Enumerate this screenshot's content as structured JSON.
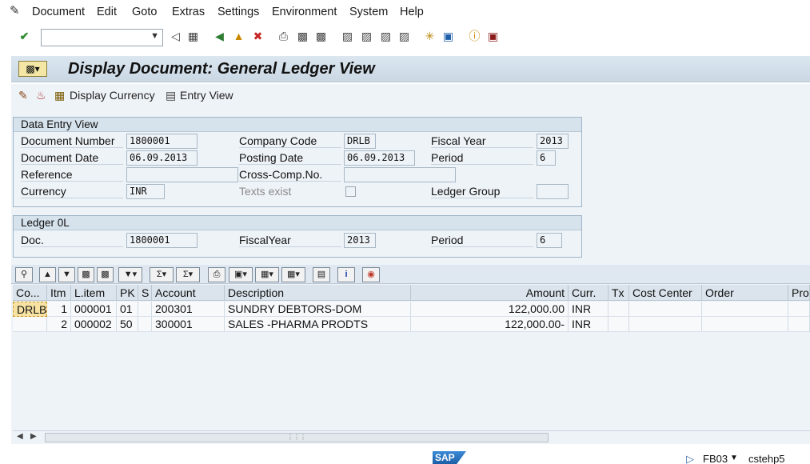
{
  "menu": [
    "Document",
    "Edit",
    "Goto",
    "Extras",
    "Settings",
    "Environment",
    "System",
    "Help"
  ],
  "toolbar": {
    "command_value": ""
  },
  "title": "Display Document: General Ledger View",
  "app_toolbar": {
    "display_currency": "Display Currency",
    "entry_view": "Entry View"
  },
  "data_entry": {
    "heading": "Data Entry View",
    "doc_number_label": "Document Number",
    "doc_number": "1800001",
    "company_code_label": "Company Code",
    "company_code": "DRLB",
    "fiscal_year_label": "Fiscal Year",
    "fiscal_year": "2013",
    "doc_date_label": "Document Date",
    "doc_date": "06.09.2013",
    "posting_date_label": "Posting Date",
    "posting_date": "06.09.2013",
    "period_label": "Period",
    "period": "6",
    "reference_label": "Reference",
    "reference": "",
    "cross_comp_label": "Cross-Comp.No.",
    "cross_comp": "",
    "currency_label": "Currency",
    "currency": "INR",
    "texts_exist_label": "Texts exist",
    "ledger_group_label": "Ledger Group",
    "ledger_group": ""
  },
  "ledger": {
    "heading": "Ledger 0L",
    "doc_label": "Doc.",
    "doc": "1800001",
    "fiscal_year_label": "FiscalYear",
    "fiscal_year": "2013",
    "period_label": "Period",
    "period": "6"
  },
  "grid": {
    "headers": [
      "Co...",
      "Itm",
      "L.item",
      "PK",
      "S",
      "Account",
      "Description",
      "Amount",
      "Curr.",
      "Tx",
      "Cost Center",
      "Order",
      "Prof"
    ],
    "rows": [
      {
        "co": "DRLB",
        "itm": "1",
        "litem": "000001",
        "pk": "01",
        "s": "",
        "account": "200301",
        "description": "SUNDRY DEBTORS-DOM",
        "amount": "122,000.00",
        "curr": "INR",
        "tx": "",
        "cost_center": "",
        "order": ""
      },
      {
        "co": "",
        "itm": "2",
        "litem": "000002",
        "pk": "50",
        "s": "",
        "account": "300001",
        "description": "SALES -PHARMA PRODTS",
        "amount": "122,000.00-",
        "curr": "INR",
        "tx": "",
        "cost_center": "",
        "order": ""
      }
    ]
  },
  "status": {
    "logo": "SAP",
    "tcode": "FB03",
    "server": "cstehp5"
  }
}
